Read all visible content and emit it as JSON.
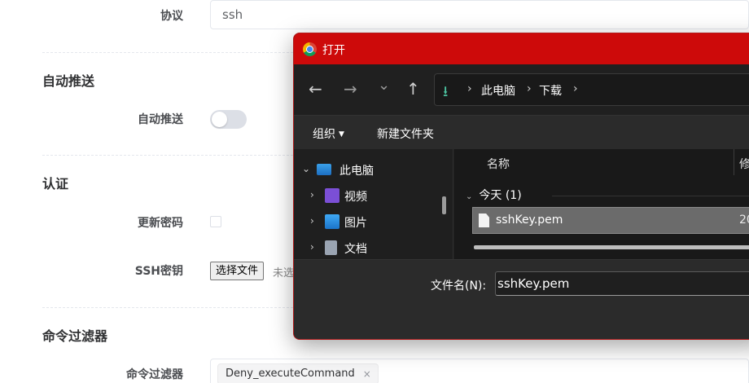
{
  "settings_form": {
    "protocol": {
      "label": "协议",
      "value": "ssh"
    },
    "auto_push_section": {
      "title": "自动推送",
      "label": "自动推送",
      "enabled": false
    },
    "auth_section": {
      "title": "认证",
      "update_password_label": "更新密码",
      "update_password_checked": false,
      "ssh_key_label": "SSH密钥",
      "choose_file_button": "选择文件",
      "no_file_hint": "未选"
    },
    "command_filter_section": {
      "title": "命令过滤器",
      "label": "命令过滤器",
      "tags": [
        "Deny_executeCommand"
      ],
      "tag_close": "×"
    }
  },
  "file_dialog": {
    "title": "打开",
    "nav": {
      "back": "←",
      "forward": "→",
      "recent": "⌄",
      "up": "↑"
    },
    "address": {
      "path": [
        "此电脑",
        "下载"
      ],
      "separator": "›"
    },
    "commands": {
      "organize": "组织",
      "new_folder": "新建文件夹"
    },
    "tree": [
      {
        "label": "此电脑",
        "expanded": true,
        "icon": "computer-icon"
      },
      {
        "label": "视频",
        "expanded": false,
        "icon": "video-folder-icon"
      },
      {
        "label": "图片",
        "expanded": false,
        "icon": "pictures-folder-icon"
      },
      {
        "label": "文档",
        "expanded": false,
        "icon": "documents-folder-icon"
      }
    ],
    "columns": {
      "name": "名称",
      "modified": "修"
    },
    "group": {
      "label": "今天 (1)"
    },
    "files": [
      {
        "name": "sshKey.pem",
        "date": "20",
        "selected": true
      }
    ],
    "filename": {
      "label": "文件名(N):",
      "value": "sshKey.pem"
    },
    "colors": {
      "titlebar": "#cd0a0a",
      "accent_download": "#4cc2a0"
    }
  }
}
